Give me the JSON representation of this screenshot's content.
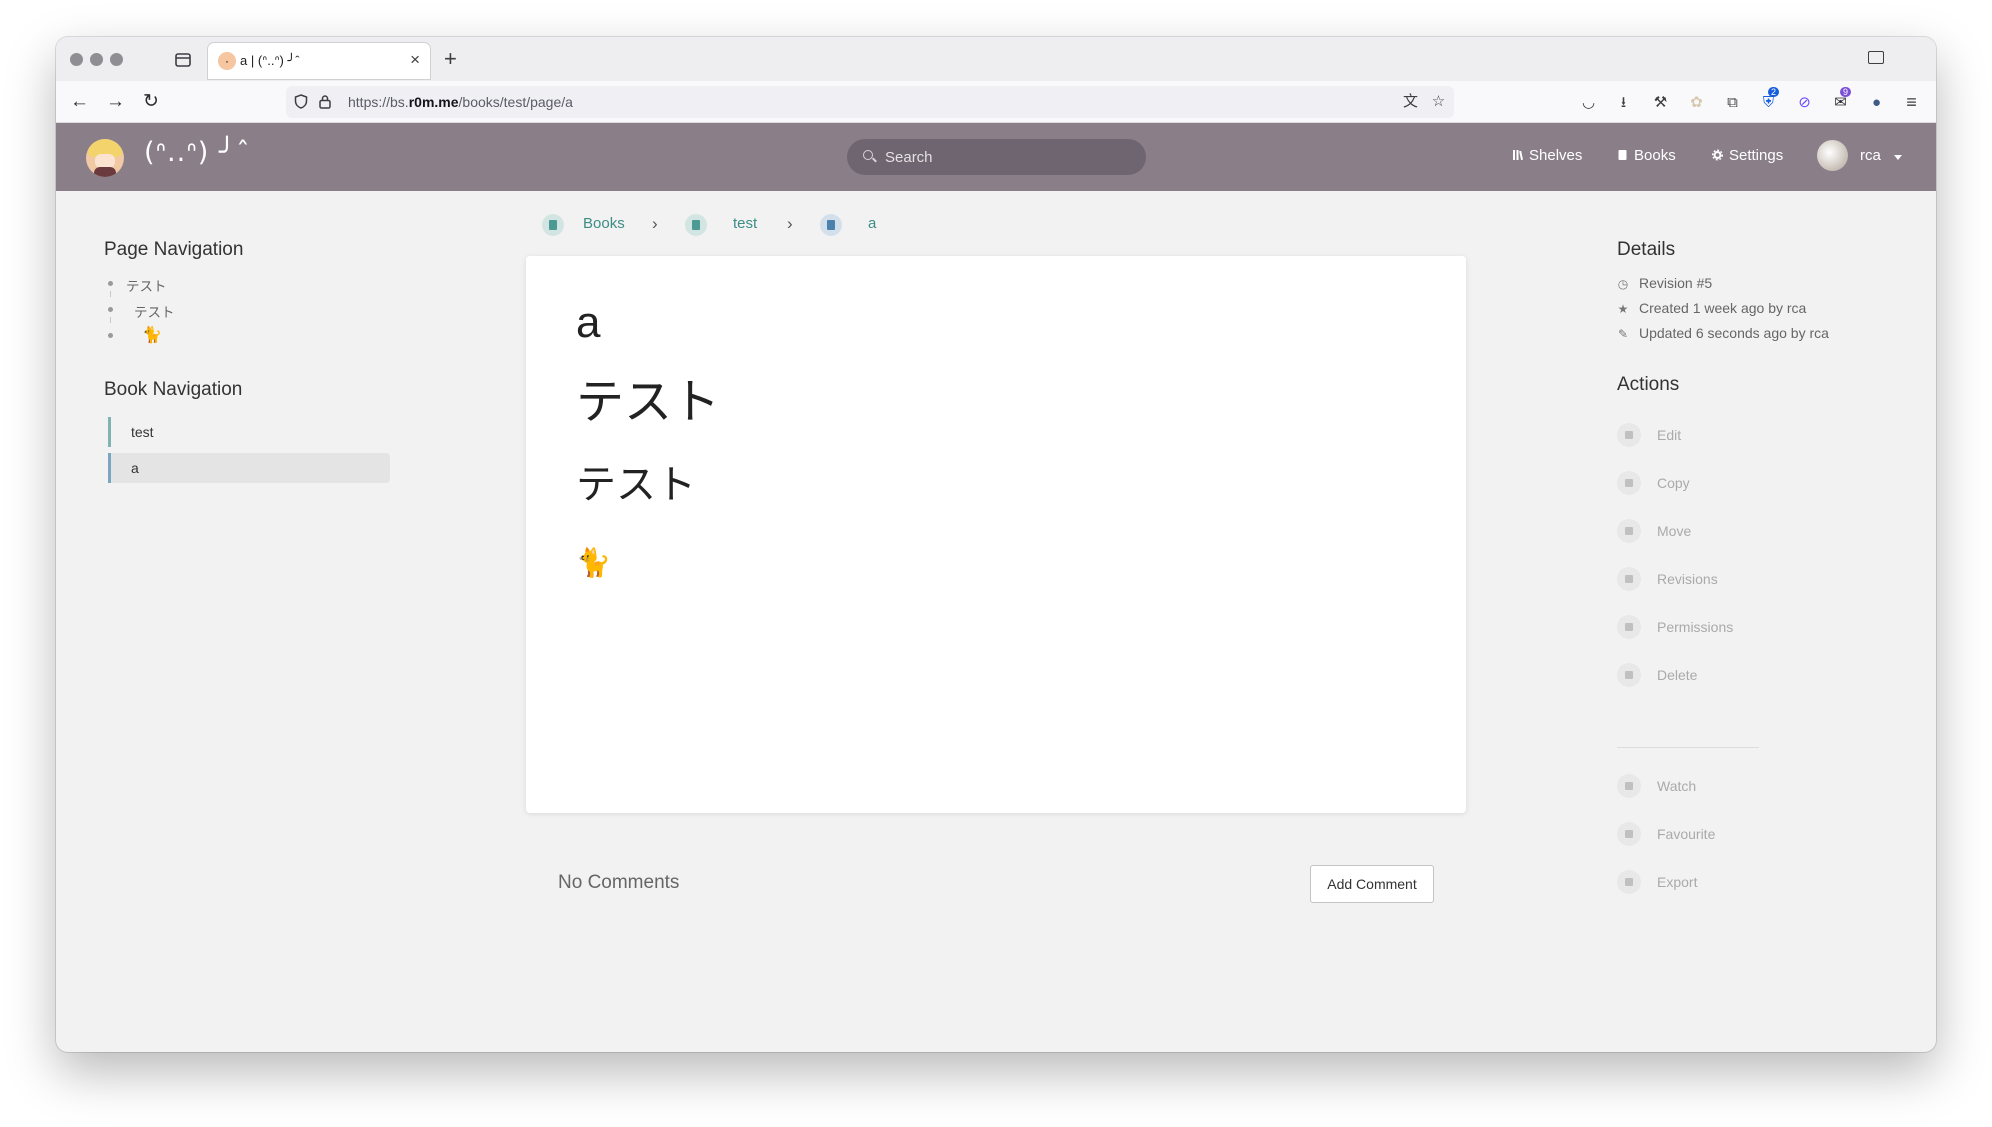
{
  "browser": {
    "tab_title": "a | (ᐢ..ᐢ) ╯ˆ",
    "tab_close": "×",
    "new_tab": "+",
    "url_scheme": "https://bs.",
    "url_host": "r0m.me",
    "url_path": "/books/test/page/a",
    "nav_back": "←",
    "nav_forward": "→",
    "nav_reload": "↻",
    "extensions": [
      {
        "name": "translate-icon",
        "glyph": "文"
      },
      {
        "name": "bookmark-star-icon",
        "glyph": "☆"
      },
      {
        "name": "pocket-icon",
        "glyph": "◡"
      },
      {
        "name": "downloads-icon",
        "glyph": "⭳"
      },
      {
        "name": "wrench-icon",
        "glyph": "⚒"
      },
      {
        "name": "extension-icon",
        "glyph": "✿"
      },
      {
        "name": "puzzle-icon",
        "glyph": "⧉"
      },
      {
        "name": "bitwarden-icon",
        "glyph": "⛨",
        "badge": "2"
      },
      {
        "name": "proton-icon",
        "glyph": "⊘"
      },
      {
        "name": "mastodon-icon",
        "glyph": "✉",
        "badge": "9"
      },
      {
        "name": "kagi-icon",
        "glyph": "●"
      },
      {
        "name": "menu-icon",
        "glyph": "≡"
      }
    ]
  },
  "header": {
    "site_name": "(ᐢ..ᐢ) ╯ˆ",
    "search_placeholder": "Search",
    "nav": [
      "Shelves",
      "Books",
      "Settings"
    ],
    "user": "rca"
  },
  "page_navigation": {
    "title": "Page Navigation",
    "items": [
      "テスト",
      "テスト",
      "🐈"
    ]
  },
  "book_navigation": {
    "title": "Book Navigation",
    "items": [
      "test",
      "a"
    ]
  },
  "breadcrumbs": [
    "Books",
    "test",
    "a"
  ],
  "page": {
    "title": "a",
    "heading_1": "テスト",
    "heading_2": "テスト",
    "paragraph": "🐈"
  },
  "comments": {
    "empty_label": "No Comments",
    "add_button": "Add Comment"
  },
  "details": {
    "title": "Details",
    "revision": "Revision #5",
    "created": "Created 1 week ago by rca",
    "updated": "Updated 6 seconds ago by rca"
  },
  "actions": {
    "title": "Actions",
    "primary": [
      "Edit",
      "Copy",
      "Move",
      "Revisions",
      "Permissions",
      "Delete"
    ],
    "secondary": [
      "Watch",
      "Favourite",
      "Export"
    ]
  }
}
